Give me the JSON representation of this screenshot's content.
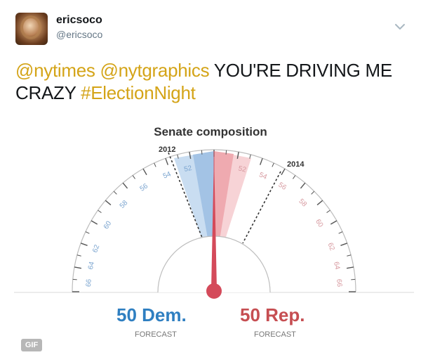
{
  "tweet": {
    "display_name": "ericsoco",
    "handle": "@ericsoco",
    "text_parts": {
      "mention1": "@nytimes",
      "mention2": "@nytgraphics",
      "body": "YOU'RE DRIVING ME CRAZY",
      "hashtag": "#ElectionNight"
    },
    "icons": {
      "menu": "chevron-down-icon",
      "avatar": "profile-photo"
    }
  },
  "media": {
    "badge": "GIF"
  },
  "chart_data": {
    "type": "gauge",
    "title": "Senate composition",
    "left_ticks": [
      "54",
      "52",
      "56",
      "58",
      "60",
      "62",
      "64",
      "66"
    ],
    "right_ticks": [
      "52",
      "54",
      "56",
      "58",
      "60",
      "62",
      "64",
      "66"
    ],
    "left_marker_label": "2012",
    "right_marker_label": "2014",
    "dem_seats": 50,
    "rep_seats": 50,
    "dem_text": "50 Dem.",
    "rep_text": "50 Rep.",
    "dem_sub": "FORECAST",
    "rep_sub": "FORECAST",
    "colors": {
      "dem": "#2f7fc1",
      "rep": "#c64e52"
    }
  }
}
